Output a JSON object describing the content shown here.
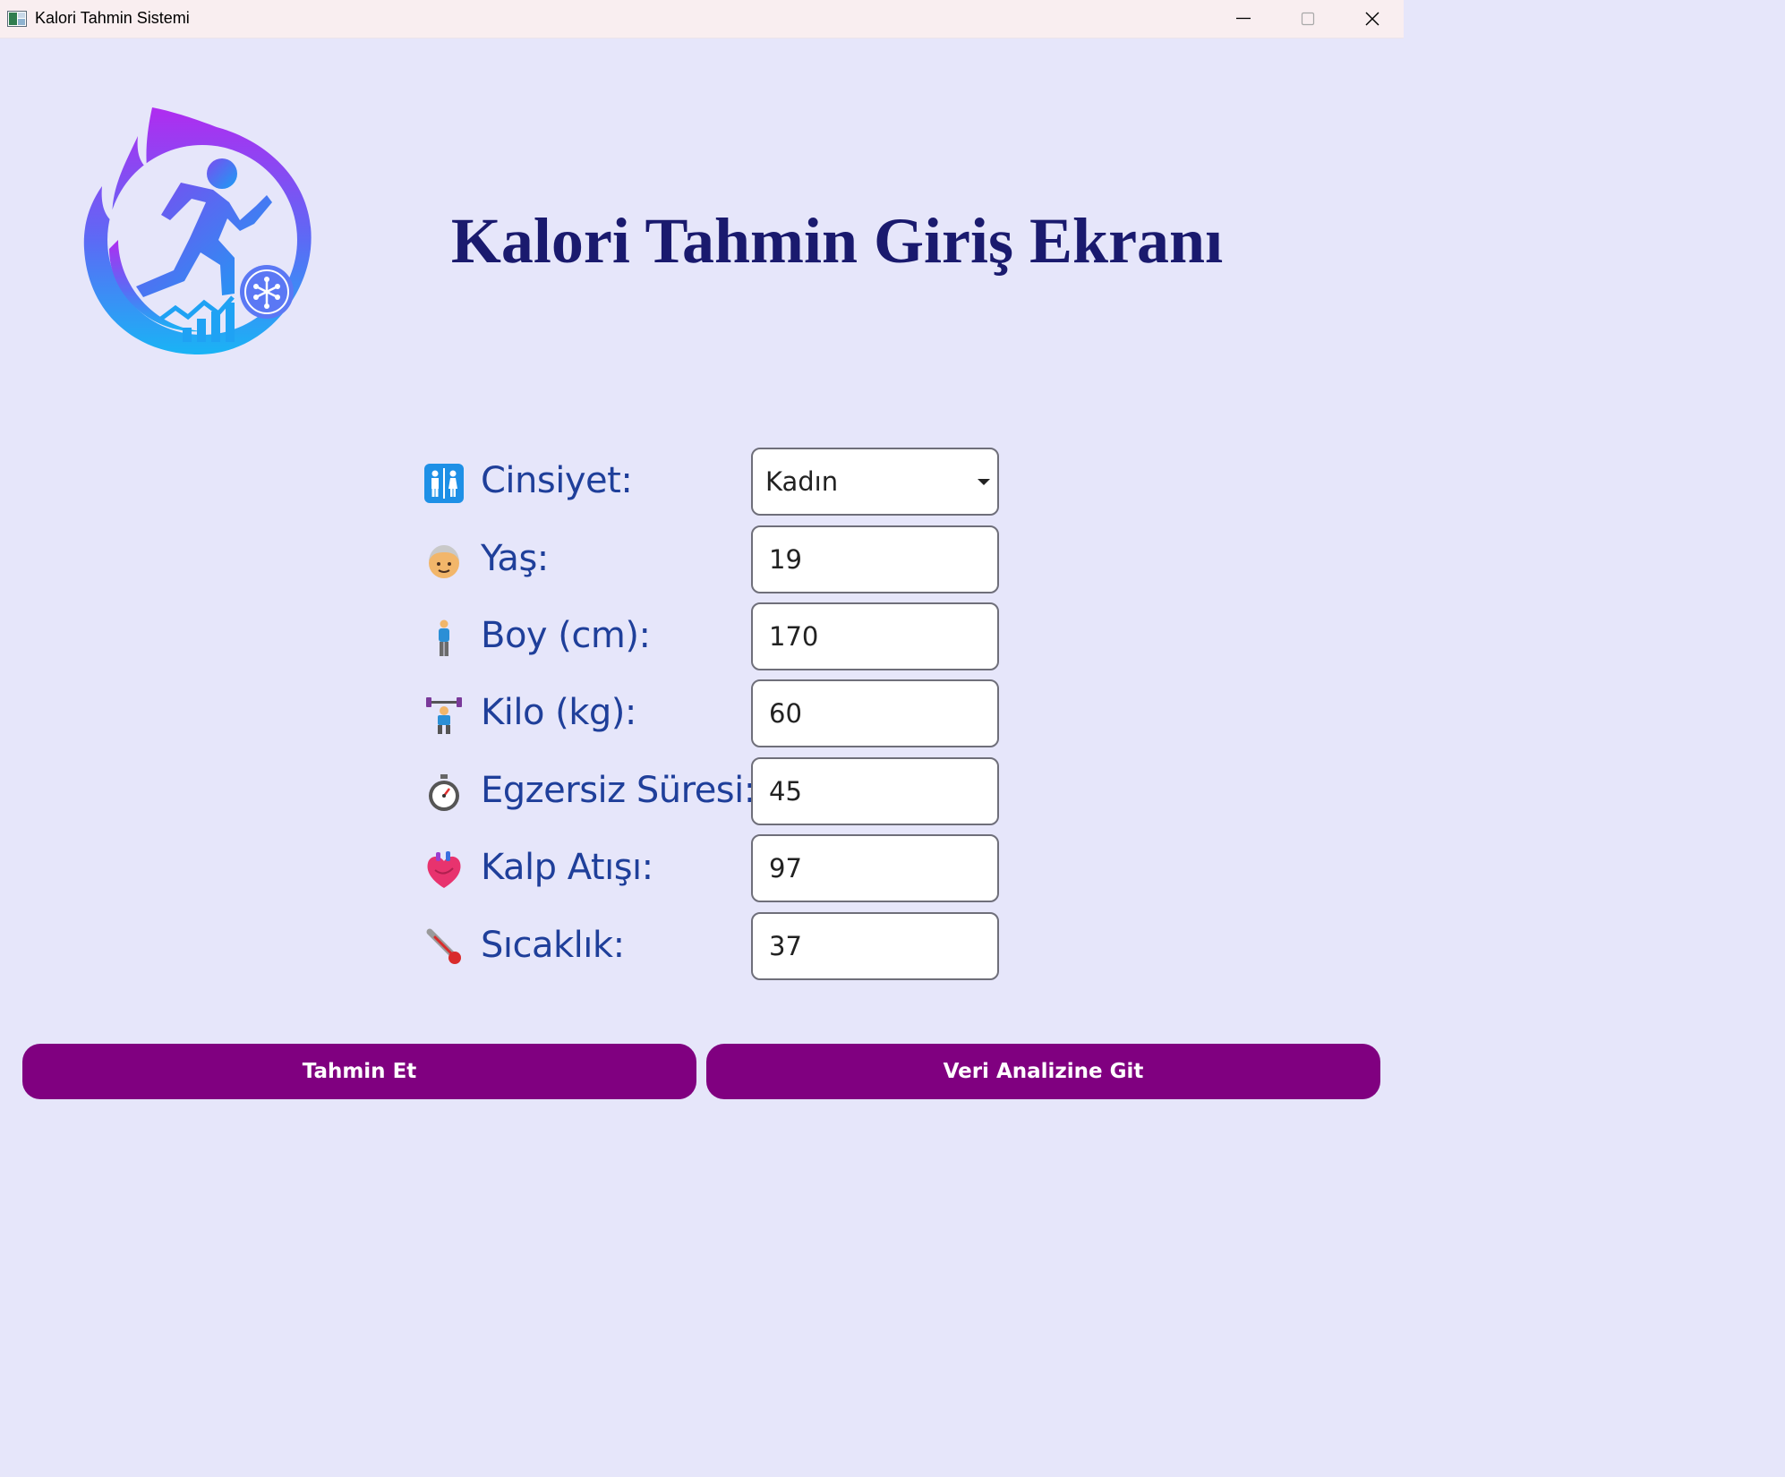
{
  "window": {
    "title": "Kalori Tahmin Sistemi",
    "icon": "app-window-icon",
    "controls": [
      "minimize-icon",
      "maximize-icon",
      "close-icon"
    ]
  },
  "header": {
    "logo": "running-person-flame-logo",
    "title": "Kalori Tahmin Giriş Ekranı"
  },
  "form": {
    "fields": [
      {
        "icon": "restroom-icon",
        "label": "Cinsiyet:",
        "type": "select",
        "value": "Kadın"
      },
      {
        "icon": "older-person-icon",
        "label": "Yaş:",
        "type": "text",
        "value": "19"
      },
      {
        "icon": "standing-person-icon",
        "label": "Boy (cm):",
        "type": "text",
        "value": "170"
      },
      {
        "icon": "weightlifter-icon",
        "label": "Kilo (kg):",
        "type": "text",
        "value": "60"
      },
      {
        "icon": "stopwatch-icon",
        "label": "Egzersiz Süresi:",
        "type": "text",
        "value": "45"
      },
      {
        "icon": "anatomical-heart-icon",
        "label": "Kalp Atışı:",
        "type": "text",
        "value": "97"
      },
      {
        "icon": "thermometer-icon",
        "label": "Sıcaklık:",
        "type": "text",
        "value": "37"
      }
    ]
  },
  "actions": {
    "predict_label": "Tahmin Et",
    "analysis_label": "Veri Analizine Git"
  },
  "colors": {
    "background": "#e6e6fa",
    "titlebar": "#f9eef0",
    "heading": "#1a1a6e",
    "label": "#1f3f9a",
    "button": "#800080",
    "button_text": "#ffffff"
  }
}
